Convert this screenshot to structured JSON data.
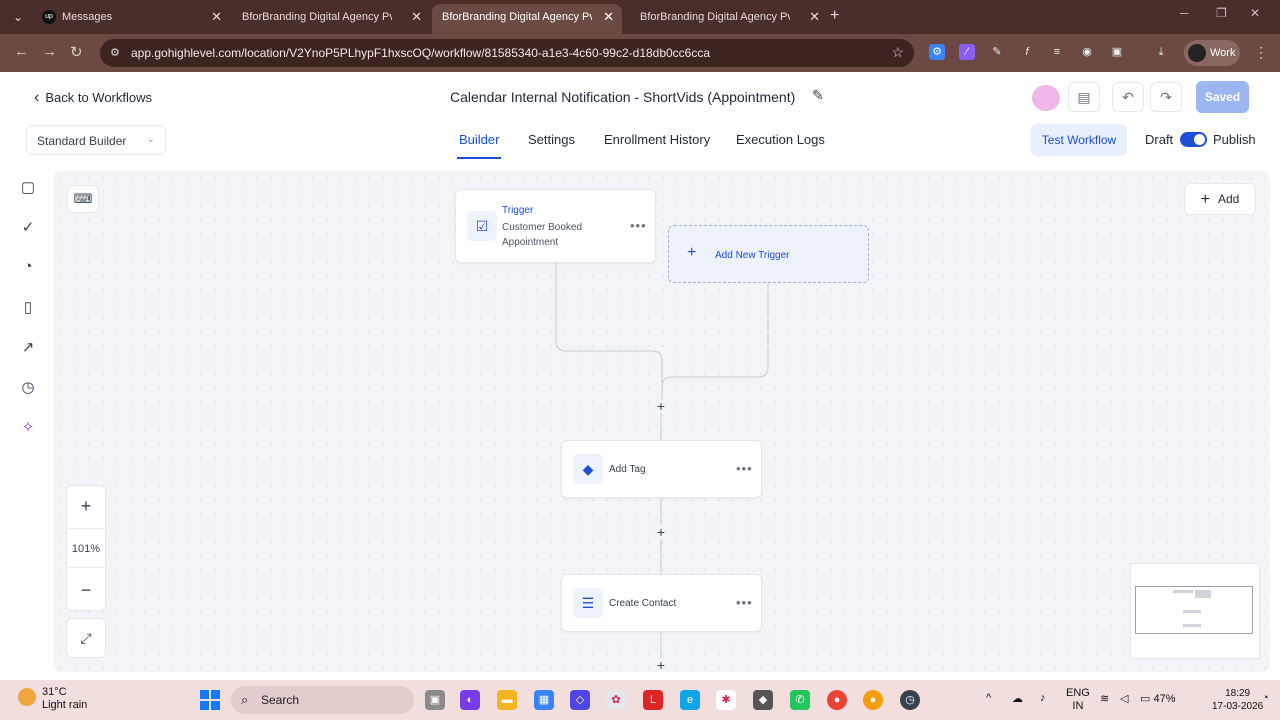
{
  "browser": {
    "tabs": [
      {
        "title": "Messages",
        "favicon": "up",
        "active": false
      },
      {
        "title": "BforBranding Digital Agency Pvt",
        "favicon": "",
        "active": false
      },
      {
        "title": "BforBranding Digital Agency Pvt",
        "favicon": "",
        "active": true
      },
      {
        "title": "BforBranding Digital Agency Pvt",
        "favicon": "",
        "active": false
      }
    ],
    "url": "app.gohighlevel.com/location/V2YnoP5PLhypF1hxscOQ/workflow/81585340-a1e3-4c60-99c2-d18db0cc6cca",
    "profile_label": "Work"
  },
  "header": {
    "back_label": "Back to Workflows",
    "title": "Calendar Internal Notification - ShortVids (Appointment)",
    "saved_label": "Saved"
  },
  "subheader": {
    "builder_select": "Standard Builder",
    "tabs": [
      {
        "label": "Builder",
        "active": true
      },
      {
        "label": "Settings",
        "active": false
      },
      {
        "label": "Enrollment History",
        "active": false
      },
      {
        "label": "Execution Logs",
        "active": false
      }
    ],
    "test_workflow_label": "Test Workflow",
    "draft_label": "Draft",
    "publish_label": "Publish",
    "published": true
  },
  "canvas": {
    "add_label": "Add",
    "zoom_level": "101%",
    "trigger": {
      "title": "Trigger",
      "subtitle": "Customer Booked Appointment"
    },
    "add_trigger_label": "Add New Trigger",
    "actions": [
      {
        "label": "Add Tag",
        "icon": "tag-icon"
      },
      {
        "label": "Create Contact",
        "icon": "contact-icon"
      }
    ]
  },
  "taskbar": {
    "temperature": "31°C",
    "condition": "Light rain",
    "search_placeholder": "Search",
    "language_line1": "ENG",
    "language_line2": "IN",
    "battery": "47%",
    "time": "18:29",
    "date": "17-03-2026"
  },
  "colors": {
    "accent": "#1d4ed8",
    "browser_frame": "#4a2e2b",
    "canvas_bg": "#f2f4f7",
    "taskbar": "#f3dede"
  }
}
